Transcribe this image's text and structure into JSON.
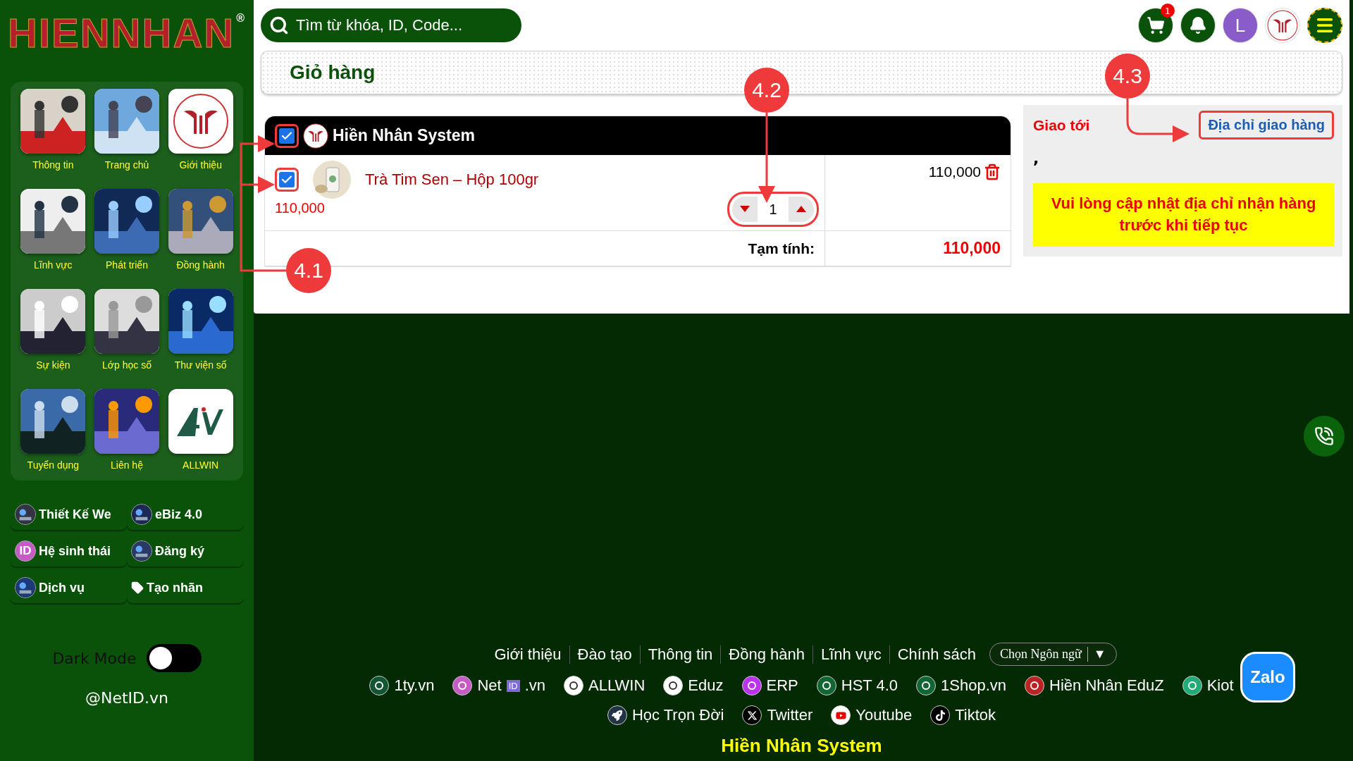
{
  "sidebar": {
    "logo": {
      "text": "HIENNHAN",
      "mark": "®"
    },
    "tiles": [
      {
        "label": "Thông tin",
        "kind": "picture"
      },
      {
        "label": "Trang chủ",
        "kind": "picture"
      },
      {
        "label": "Giới thiệu",
        "kind": "logo"
      },
      {
        "label": "Lĩnh vực",
        "kind": "picture"
      },
      {
        "label": "Phát triển",
        "kind": "picture"
      },
      {
        "label": "Đồng hành",
        "kind": "picture"
      },
      {
        "label": "Sự kiện",
        "kind": "picture"
      },
      {
        "label": "Lớp học số",
        "kind": "picture"
      },
      {
        "label": "Thư viện số",
        "kind": "picture"
      },
      {
        "label": "Tuyển dụng",
        "kind": "picture"
      },
      {
        "label": "Liên hệ",
        "kind": "picture"
      },
      {
        "label": "ALLWIN",
        "kind": "allwin"
      }
    ],
    "menu": [
      {
        "label": "Thiết Kế We",
        "kind": "picture"
      },
      {
        "label": "eBiz 4.0",
        "kind": "picture"
      },
      {
        "label": "Hệ sinh thái",
        "kind": "letters",
        "icon_text": "ID"
      },
      {
        "label": "Đăng ký",
        "kind": "picture"
      },
      {
        "label": "Dịch vụ",
        "kind": "picture"
      },
      {
        "label": "Tạo nhãn",
        "kind": "tag"
      }
    ],
    "dark_mode": {
      "label": "Dark Mode",
      "on": false
    },
    "handle": "@NetID.vn"
  },
  "header": {
    "search": {
      "placeholder": "Tìm từ khóa, ID, Code..."
    },
    "cart_count": "1",
    "avatar_letter": "L"
  },
  "page_title": "Giỏ hàng",
  "cart": {
    "shop": {
      "name": "Hiền Nhân System",
      "checked": true,
      "highlighted": true
    },
    "items": [
      {
        "name": "Trà Tim Sen – Hộp 100gr",
        "unit_price": "110,000",
        "quantity": "1",
        "line_total": "110,000",
        "checked": true,
        "highlighted": true,
        "quantity_highlighted": true
      }
    ],
    "subtotal_label": "Tạm tính:",
    "subtotal": "110,000"
  },
  "shipping": {
    "label": "Giao tới",
    "link": "Địa chỉ giao hàng",
    "link_highlighted": true,
    "address": ",",
    "warning": "Vui lòng cập nhật địa chỉ nhận hàng trước khi tiếp tục"
  },
  "footer": {
    "links": [
      "Giới thiệu",
      "Đào tạo",
      "Thông tin",
      "Đồng hành",
      "Lĩnh vực",
      "Chính sách"
    ],
    "language": {
      "label": "Chọn Ngôn ngữ",
      "caret": "▼"
    },
    "sites": [
      {
        "label": "1ty.vn"
      },
      {
        "label": "Net",
        "badge": "ID",
        "suffix": ".vn"
      },
      {
        "label": "ALLWIN"
      },
      {
        "label": "Eduz"
      },
      {
        "label": "ERP"
      },
      {
        "label": "HST 4.0"
      },
      {
        "label": "1Shop.vn"
      },
      {
        "label": "Hiền Nhân EduZ"
      },
      {
        "label": "Kiot"
      }
    ],
    "social": [
      {
        "label": "Học Trọn Đời",
        "kind": "rocket"
      },
      {
        "label": "Twitter",
        "kind": "x"
      },
      {
        "label": "Youtube",
        "kind": "youtube"
      },
      {
        "label": "Tiktok",
        "kind": "tiktok"
      }
    ],
    "brand": "Hiền Nhân System"
  },
  "zalo": "Zalo",
  "annotations": [
    {
      "label": "4.1"
    },
    {
      "label": "4.2"
    },
    {
      "label": "4.3"
    }
  ]
}
